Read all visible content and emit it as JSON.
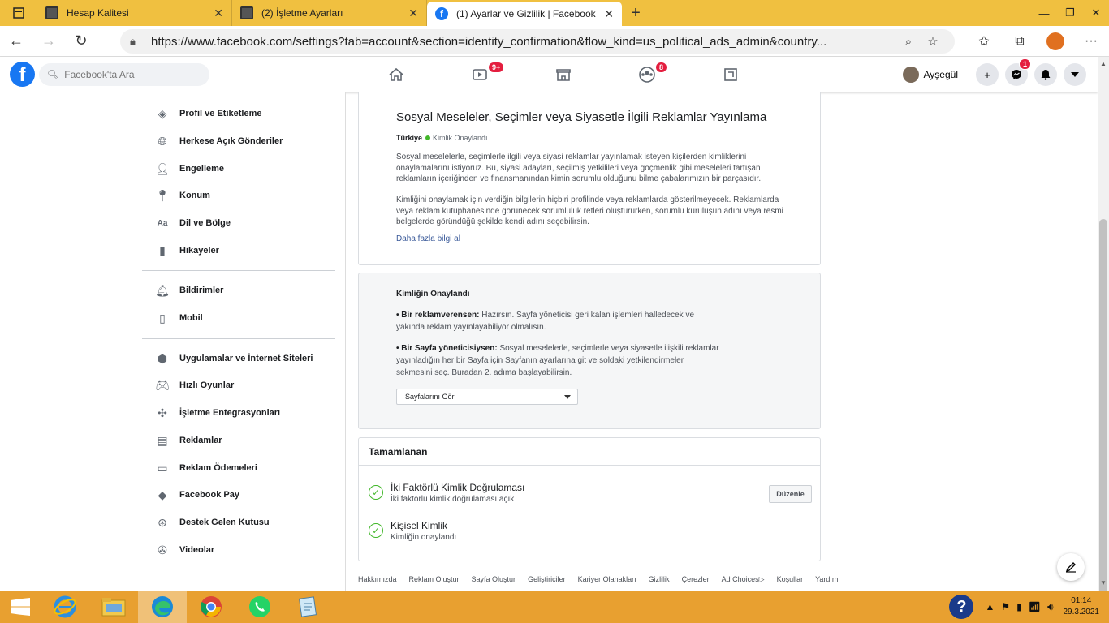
{
  "browser": {
    "tabs": [
      {
        "title": "Hesap Kalitesi",
        "close": "✕"
      },
      {
        "title": "(2) İşletme Ayarları",
        "close": "✕"
      },
      {
        "title": "(1) Ayarlar ve Gizlilik | Facebook",
        "close": "✕"
      }
    ],
    "new_tab": "+",
    "url": "https://www.facebook.com/settings?tab=account&section=identity_confirmation&flow_kind=us_political_ads_admin&country..."
  },
  "fb_header": {
    "search_placeholder": "Facebook'ta Ara",
    "watch_badge": "9+",
    "groups_badge": "8",
    "user_name": "Ayşegül",
    "messenger_badge": "1"
  },
  "sidebar": {
    "items": [
      {
        "label": "Profil ve Etiketleme",
        "icon": "tag-icon"
      },
      {
        "label": "Herkese Açık Gönderiler",
        "icon": "globe-icon"
      },
      {
        "label": "Engelleme",
        "icon": "block-user-icon"
      },
      {
        "label": "Konum",
        "icon": "location-pin-icon"
      },
      {
        "label": "Dil ve Bölge",
        "icon": "language-icon"
      },
      {
        "label": "Hikayeler",
        "icon": "book-icon"
      },
      {
        "label": "Bildirimler",
        "icon": "bell-icon"
      },
      {
        "label": "Mobil",
        "icon": "mobile-icon"
      },
      {
        "label": "Uygulamalar ve İnternet Siteleri",
        "icon": "cube-icon"
      },
      {
        "label": "Hızlı Oyunlar",
        "icon": "gamepad-icon"
      },
      {
        "label": "İşletme Entegrasyonları",
        "icon": "puzzle-icon"
      },
      {
        "label": "Reklamlar",
        "icon": "ad-icon"
      },
      {
        "label": "Reklam Ödemeleri",
        "icon": "credit-card-icon"
      },
      {
        "label": "Facebook Pay",
        "icon": "pay-icon"
      },
      {
        "label": "Destek Gelen Kutusu",
        "icon": "lifebuoy-icon"
      },
      {
        "label": "Videolar",
        "icon": "film-icon"
      }
    ]
  },
  "political_ads": {
    "title": "Sosyal Meseleler, Seçimler veya Siyasetle İlgili Reklamlar Yayınlama",
    "country": "Türkiye",
    "status": "Kimlik Onaylandı",
    "p1": "Sosyal meselelerle, seçimlerle ilgili veya siyasi reklamlar yayınlamak isteyen kişilerden kimliklerini onaylamalarını istiyoruz. Bu, siyasi adayları, seçilmiş yetkilileri veya göçmenlik gibi meseleleri tartışan reklamların içeriğinden ve finansmanından kimin sorumlu olduğunu bilme çabalarımızın bir parçasıdır.",
    "p2": "Kimliğini onaylamak için verdiğin bilgilerin hiçbiri profilinde veya reklamlarda gösterilmeyecek. Reklamlarda veya reklam kütüphanesinde görünecek sorumluluk retleri oluştururken, sorumlu kuruluşun adını veya resmi belgelerde göründüğü şekilde kendi adını seçebilirsin.",
    "learn_more": "Daha fazla bilgi al"
  },
  "identity_confirmed": {
    "title": "Kimliğin Onaylandı",
    "advertiser_label": "• Bir reklamverensen:",
    "advertiser_text": "Hazırsın. Sayfa yöneticisi geri kalan işlemleri halledecek ve yakında reklam yayınlayabiliyor olmalısın.",
    "page_admin_label": "• Bir Sayfa yöneticisiysen:",
    "page_admin_text": "Sosyal meselelerle, seçimlerle veya siyasetle ilişkili reklamlar yayınladığın her bir Sayfa için Sayfanın ayarlarına git ve soldaki yetkilendirmeler sekmesini seç. Buradan 2. adıma başlayabilirsin.",
    "select_value": "Sayfalarını Gör"
  },
  "completed": {
    "title": "Tamamlanan",
    "items": [
      {
        "title": "İki Faktörlü Kimlik Doğrulaması",
        "subtitle": "İki faktörlü kimlik doğrulaması açık"
      },
      {
        "title": "Kişisel Kimlik",
        "subtitle": "Kimliğin onaylandı"
      }
    ],
    "edit_label": "Düzenle"
  },
  "footer": [
    "Hakkımızda",
    "Reklam Oluştur",
    "Sayfa Oluştur",
    "Geliştiriciler",
    "Kariyer Olanakları",
    "Gizlilik",
    "Çerezler",
    "Ad Choices▷",
    "Koşullar",
    "Yardım"
  ],
  "taskbar": {
    "time": "01:14",
    "date": "29.3.2021",
    "help": "?"
  },
  "colors": {
    "fb_blue": "#1877f2",
    "tab_bar": "#f0c040",
    "taskbar": "#e8a030",
    "verified_green": "#42b72a"
  }
}
